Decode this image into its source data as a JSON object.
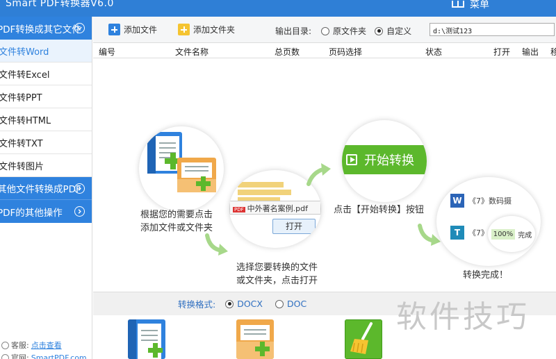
{
  "window": {
    "title": "Smart PDF转换器V6.0",
    "menu_label": "菜单"
  },
  "sidebar": {
    "sections": [
      {
        "label": "PDF转换成其它文件",
        "items": [
          "文件转Word",
          "文件转Excel",
          "文件转PPT",
          "文件转HTML",
          "文件转TXT",
          "文件转图片"
        ]
      },
      {
        "label": "其他文件转换成PDF"
      },
      {
        "label": "PDF的其他操作"
      }
    ],
    "footer": {
      "service_label": "客服:",
      "service_link": "点击查看",
      "website_label": "官网:",
      "website_link": "SmartPDF.com"
    }
  },
  "toolbar": {
    "add_file": "添加文件",
    "add_folder": "添加文件夹",
    "output_dir_label": "输出目录:",
    "option_original": "原文件夹",
    "option_custom": "自定义",
    "path_value": "d:\\测试123"
  },
  "table": {
    "columns": [
      "编号",
      "文件名称",
      "总页数",
      "页码选择",
      "状态",
      "打开",
      "输出",
      "移除"
    ]
  },
  "guide": {
    "step1": [
      "根据您的需要点击",
      "添加文件或文件夹"
    ],
    "step2": [
      "选择您要转换的文件",
      "或文件夹，点击打开"
    ],
    "step3": "点击【开始转换】按钮",
    "step4": "转换完成！",
    "start_button": "开始转换",
    "dialog_file": "中外著名案例.pdf",
    "dialog_open": "打开",
    "result_1": "《7》数码摄",
    "result_2": "《7》",
    "progress": "100%",
    "done": "完成"
  },
  "format": {
    "label": "转换格式:",
    "options": [
      "DOCX",
      "DOC"
    ],
    "selected": "DOCX"
  },
  "watermark": "软件技巧",
  "colors": {
    "primary": "#2f82de",
    "green": "#5cb82c",
    "folder": "#f5c431"
  }
}
